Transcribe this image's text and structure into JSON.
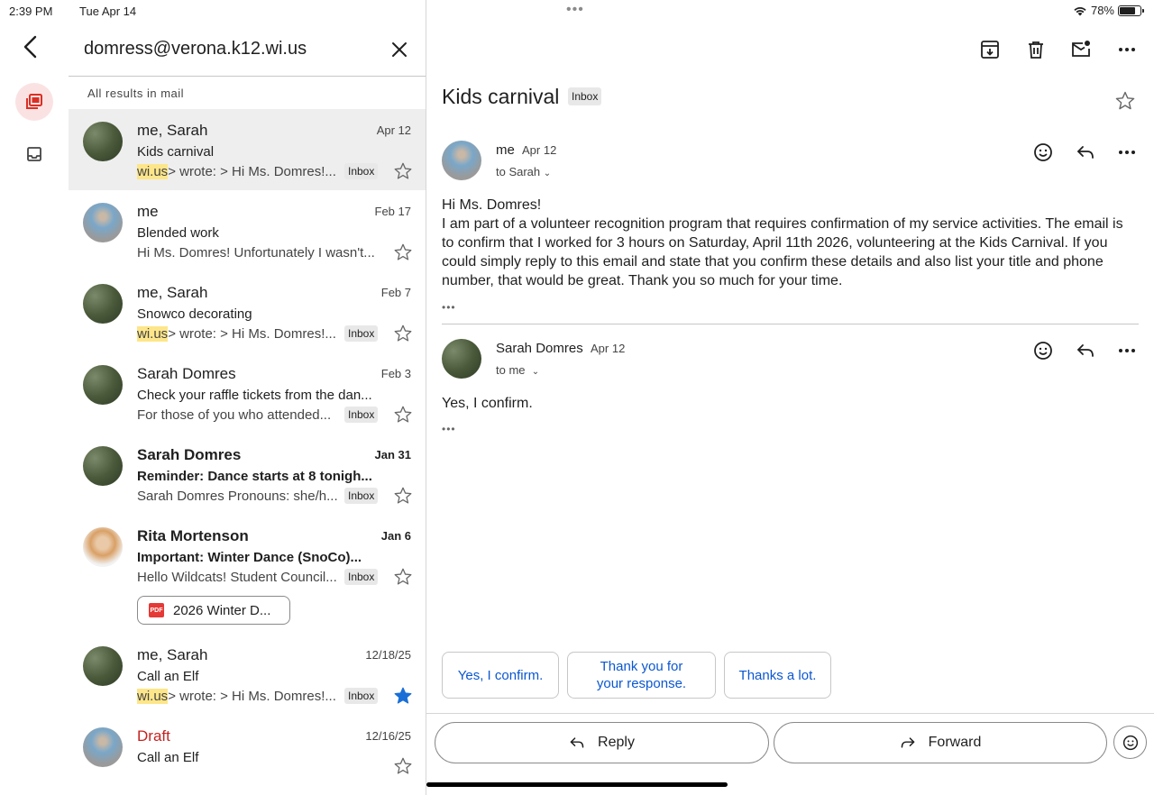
{
  "status": {
    "time": "2:39 PM",
    "date": "Tue Apr 14",
    "battery": "78%",
    "battery_level": 0.78
  },
  "search": {
    "query": "domress@verona.k12.wi.us",
    "results_label": "All results in mail"
  },
  "mails": [
    {
      "sender": "me, Sarah",
      "date": "Apr 12",
      "subject": "Kids carnival",
      "snippet_hl": "wi.us",
      "snippet": "> wrote: > Hi Ms. Domres!...",
      "label": "Inbox",
      "starred": false
    },
    {
      "sender": "me",
      "date": "Feb 17",
      "subject": "Blended work",
      "snippet_hl": "",
      "snippet": "Hi Ms. Domres! Unfortunately I wasn't...",
      "label": "",
      "starred": false
    },
    {
      "sender": "me, Sarah",
      "date": "Feb 7",
      "subject": "Snowco decorating",
      "snippet_hl": "wi.us",
      "snippet": "> wrote: > Hi Ms. Domres!...",
      "label": "Inbox",
      "starred": false
    },
    {
      "sender": "Sarah Domres",
      "date": "Feb 3",
      "subject": "Check your raffle tickets from the dan...",
      "snippet_hl": "",
      "snippet": "For those of you who attended...",
      "label": "Inbox",
      "starred": false
    },
    {
      "sender": "Sarah Domres",
      "date": "Jan 31",
      "subject": "Reminder: Dance starts at 8 tonigh...",
      "snippet_hl": "",
      "snippet": "Sarah Domres Pronouns: she/h...",
      "label": "Inbox",
      "starred": false
    },
    {
      "sender": "Rita Mortenson",
      "date": "Jan 6",
      "subject": "Important: Winter Dance (SnoCo)...",
      "snippet_hl": "",
      "snippet": "Hello Wildcats! Student Council...",
      "label": "Inbox",
      "starred": false,
      "attachment": "2026 Winter D...",
      "attachment_type": "PDF"
    },
    {
      "sender": "me, Sarah",
      "date": "12/18/25",
      "subject": "Call an Elf",
      "snippet_hl": "wi.us",
      "snippet": "> wrote: > Hi Ms. Domres!...",
      "label": "Inbox",
      "starred": true
    },
    {
      "sender": "Draft",
      "date": "12/16/25",
      "subject": "Call an Elf",
      "snippet_hl": "",
      "snippet": "",
      "label": "",
      "starred": false
    }
  ],
  "thread": {
    "title": "Kids carnival",
    "label": "Inbox",
    "messages": [
      {
        "from": "me",
        "date": "Apr 12",
        "to": "to Sarah",
        "greeting": "Hi Ms. Domres!",
        "body": "I am part of a volunteer recognition program that requires confirmation of my service activities. The email is to confirm that I worked for 3 hours on Saturday, April 11th 2026, volunteering at the Kids Carnival. If you could simply reply to this email and state that you confirm these details and also list your title and phone number, that would be great. Thank you so much for your time."
      },
      {
        "from": "Sarah Domres",
        "date": "Apr 12",
        "to": "to me",
        "body": "Yes, I confirm."
      }
    ],
    "ellipsis": "•••"
  },
  "smart_replies": [
    "Yes, I confirm.",
    "Thank you for your response.",
    "Thanks a lot."
  ],
  "actions": {
    "reply": "Reply",
    "forward": "Forward"
  },
  "colors": {
    "accent_red": "#d93025",
    "link_blue": "#0b57d0",
    "highlight": "#fde68a",
    "star_blue": "#1a6fd6"
  }
}
